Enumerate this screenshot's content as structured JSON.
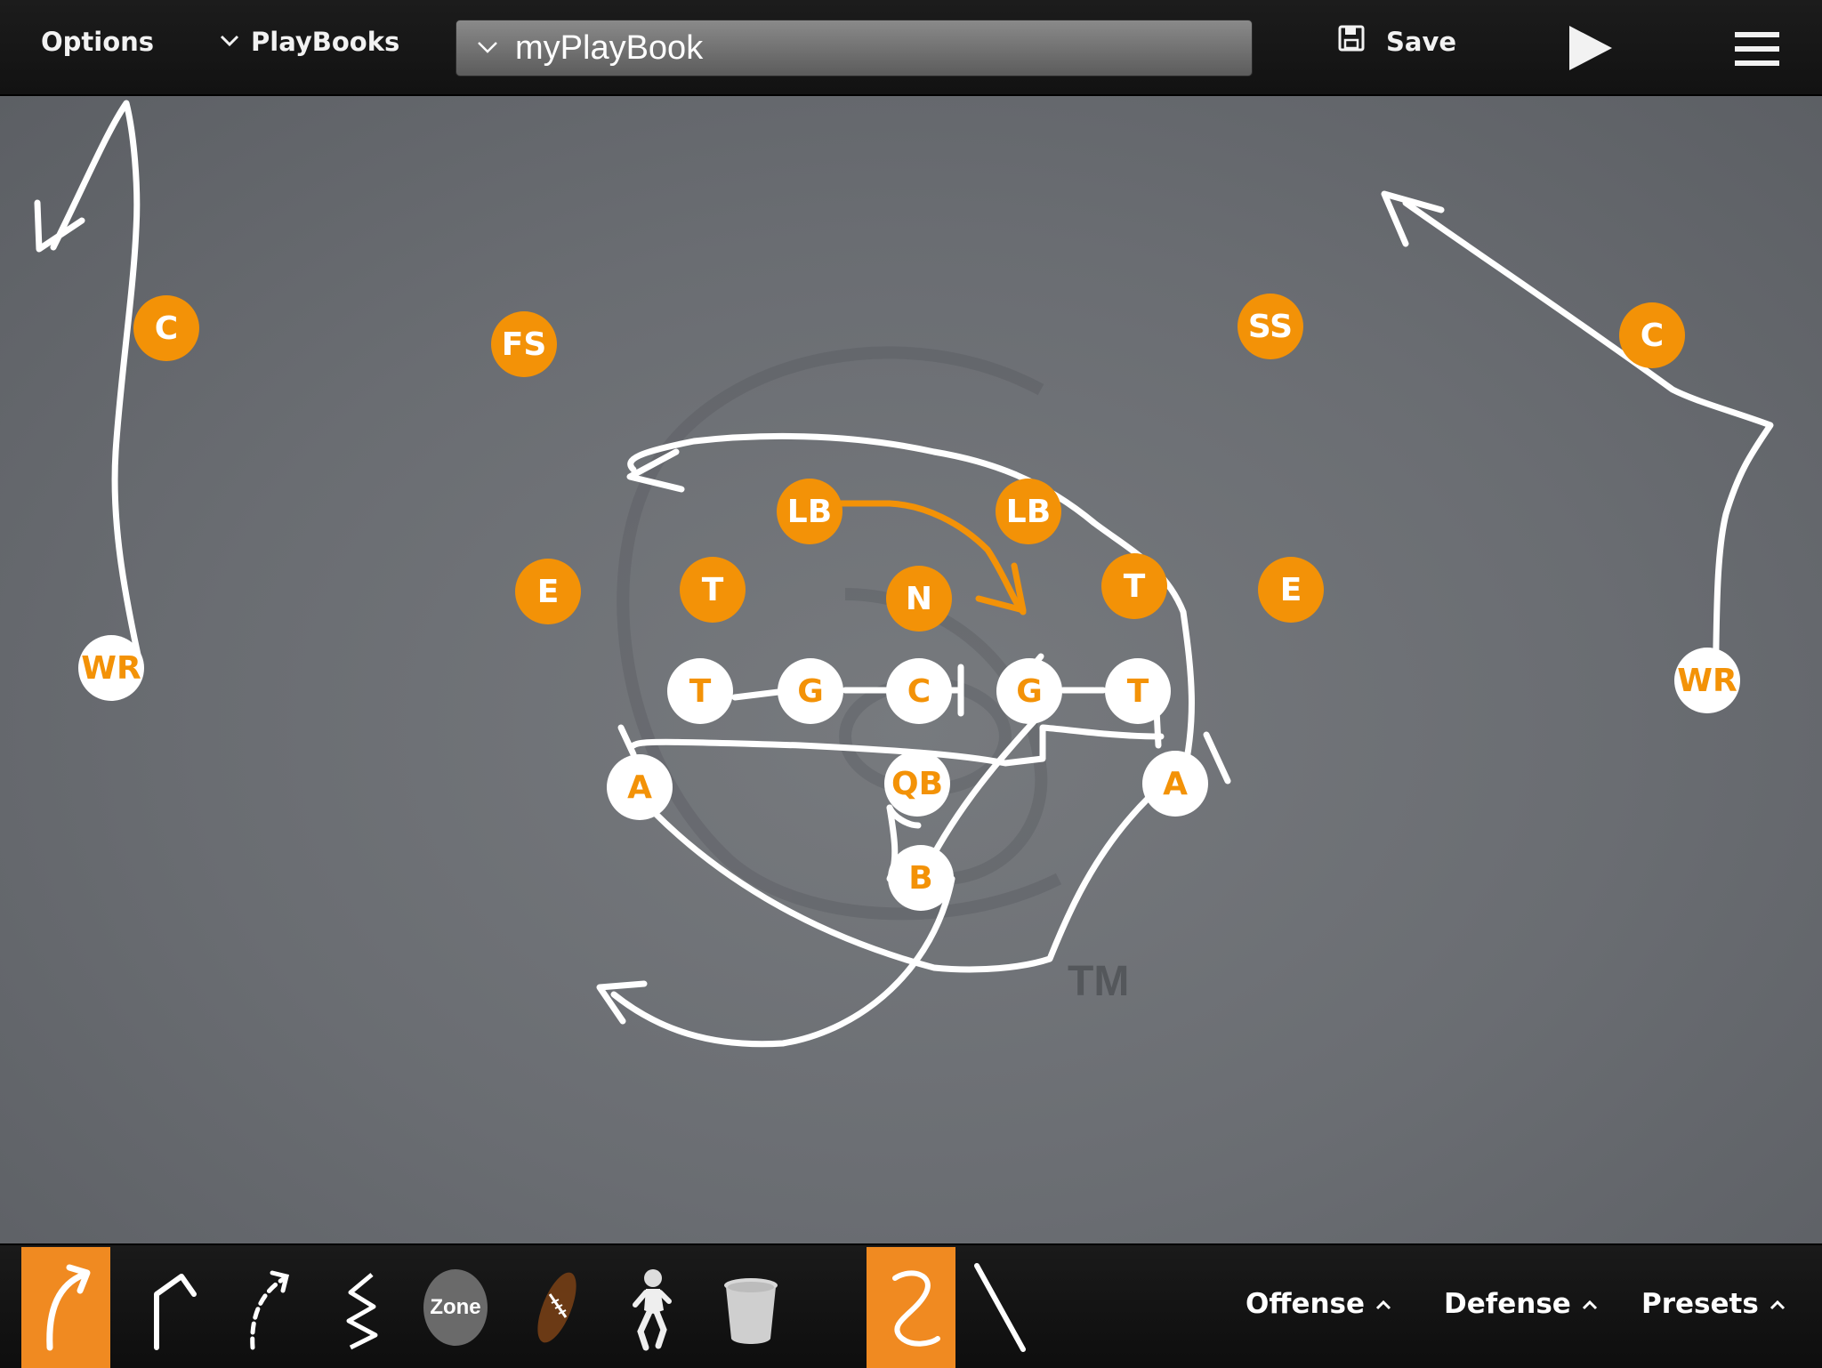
{
  "toolbar": {
    "options_label": "Options",
    "playbooks_label": "PlayBooks",
    "playbook_name": "myPlayBook",
    "save_label": "Save",
    "play_icon": "play-icon",
    "menu_icon": "hamburger-icon"
  },
  "field": {
    "watermark_tm": "TM"
  },
  "players": {
    "defense": {
      "c_left": "C",
      "fs": "FS",
      "ss": "SS",
      "c_right": "C",
      "lb_left": "LB",
      "lb_right": "LB",
      "e_left": "E",
      "t_left": "T",
      "n": "N",
      "t_right": "T",
      "e_right": "E"
    },
    "offense": {
      "wr_left": "WR",
      "wr_right": "WR",
      "t_left": "T",
      "g_left": "G",
      "c": "C",
      "g_right": "G",
      "t_right": "T",
      "a_left": "A",
      "qb": "QB",
      "a_right": "A",
      "b": "B"
    }
  },
  "bottom": {
    "tools": [
      "curved-route-tool",
      "angled-route-tool",
      "dashed-route-tool",
      "zigzag-route-tool",
      "zone-tool",
      "football-tool",
      "player-tool",
      "trash-tool",
      "freehand-draw-tool",
      "straight-line-tool"
    ],
    "zone_label": "Zone",
    "offense_label": "Offense",
    "defense_label": "Defense",
    "presets_label": "Presets"
  },
  "colors": {
    "accent": "#f39207",
    "field": "#6a6d72",
    "route": "#ffffff"
  }
}
